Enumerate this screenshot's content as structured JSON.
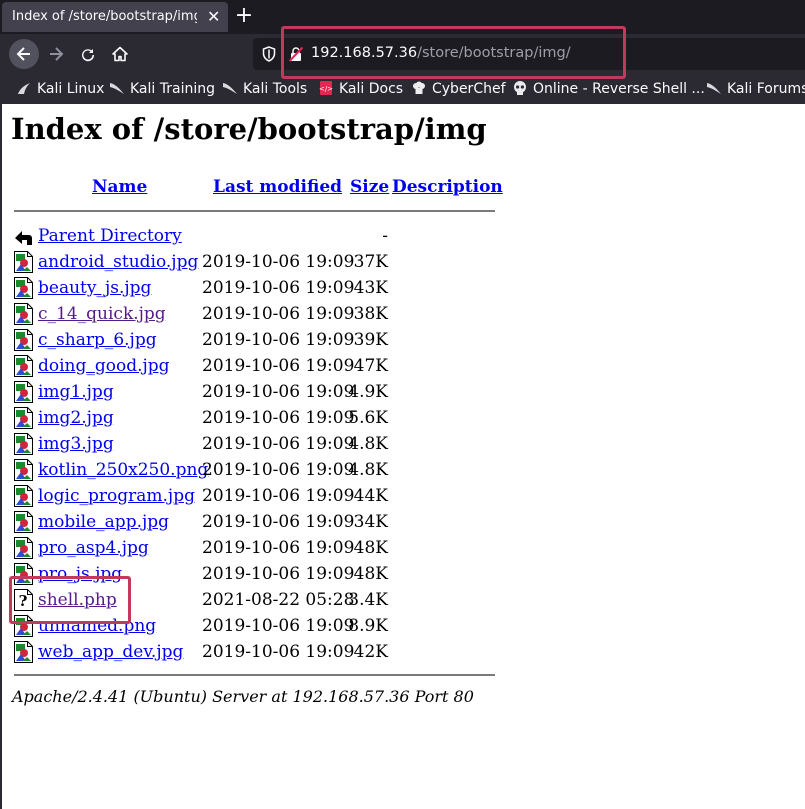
{
  "browser": {
    "tab_title": "Index of /store/bootstrap/img/",
    "url_host": "192.168.57.36",
    "url_path": "/store/bootstrap/img/",
    "bookmarks": [
      {
        "label": "Kali Linux",
        "icon": "kali-dragon-icon"
      },
      {
        "label": "Kali Training",
        "icon": "kali-dragon-icon"
      },
      {
        "label": "Kali Tools",
        "icon": "kali-dragon-icon"
      },
      {
        "label": "Kali Docs",
        "icon": "kali-docs-icon"
      },
      {
        "label": "CyberChef",
        "icon": "chef-hat-icon"
      },
      {
        "label": "Online - Reverse Shell ...",
        "icon": "skull-icon"
      },
      {
        "label": "Kali Forums",
        "icon": "kali-dragon-icon"
      }
    ],
    "highlight_color": "#c23a5b"
  },
  "page": {
    "title": "Index of /store/bootstrap/img",
    "columns": {
      "name": "Name",
      "modified": "Last modified",
      "size": "Size",
      "description": "Description"
    },
    "entries": [
      {
        "name": "Parent Directory",
        "modified": "",
        "size": "-",
        "icon": "back-arrow-icon",
        "visited": false
      },
      {
        "name": "android_studio.jpg",
        "modified": "2019-10-06 19:09",
        "size": "37K",
        "icon": "image-file-icon",
        "visited": false
      },
      {
        "name": "beauty_js.jpg",
        "modified": "2019-10-06 19:09",
        "size": "43K",
        "icon": "image-file-icon",
        "visited": false
      },
      {
        "name": "c_14_quick.jpg",
        "modified": "2019-10-06 19:09",
        "size": "38K",
        "icon": "image-file-icon",
        "visited": true
      },
      {
        "name": "c_sharp_6.jpg",
        "modified": "2019-10-06 19:09",
        "size": "39K",
        "icon": "image-file-icon",
        "visited": false
      },
      {
        "name": "doing_good.jpg",
        "modified": "2019-10-06 19:09",
        "size": "47K",
        "icon": "image-file-icon",
        "visited": false
      },
      {
        "name": "img1.jpg",
        "modified": "2019-10-06 19:09",
        "size": "4.9K",
        "icon": "image-file-icon",
        "visited": false
      },
      {
        "name": "img2.jpg",
        "modified": "2019-10-06 19:09",
        "size": "5.6K",
        "icon": "image-file-icon",
        "visited": false
      },
      {
        "name": "img3.jpg",
        "modified": "2019-10-06 19:09",
        "size": "4.8K",
        "icon": "image-file-icon",
        "visited": false
      },
      {
        "name": "kotlin_250x250.png",
        "modified": "2019-10-06 19:09",
        "size": "4.8K",
        "icon": "image-file-icon",
        "visited": false
      },
      {
        "name": "logic_program.jpg",
        "modified": "2019-10-06 19:09",
        "size": "44K",
        "icon": "image-file-icon",
        "visited": false
      },
      {
        "name": "mobile_app.jpg",
        "modified": "2019-10-06 19:09",
        "size": "34K",
        "icon": "image-file-icon",
        "visited": false
      },
      {
        "name": "pro_asp4.jpg",
        "modified": "2019-10-06 19:09",
        "size": "48K",
        "icon": "image-file-icon",
        "visited": false
      },
      {
        "name": "pro_js.jpg",
        "modified": "2019-10-06 19:09",
        "size": "48K",
        "icon": "image-file-icon",
        "visited": false
      },
      {
        "name": "shell.php",
        "modified": "2021-08-22 05:28",
        "size": "3.4K",
        "icon": "unknown-file-icon",
        "visited": true
      },
      {
        "name": "unnamed.png",
        "modified": "2019-10-06 19:09",
        "size": "8.9K",
        "icon": "image-file-icon",
        "visited": false
      },
      {
        "name": "web_app_dev.jpg",
        "modified": "2019-10-06 19:09",
        "size": "42K",
        "icon": "image-file-icon",
        "visited": false
      }
    ],
    "server_signature": "Apache/2.4.41 (Ubuntu) Server at 192.168.57.36 Port 80",
    "link_color": "#0000ee",
    "visited_color": "#551a8b"
  }
}
